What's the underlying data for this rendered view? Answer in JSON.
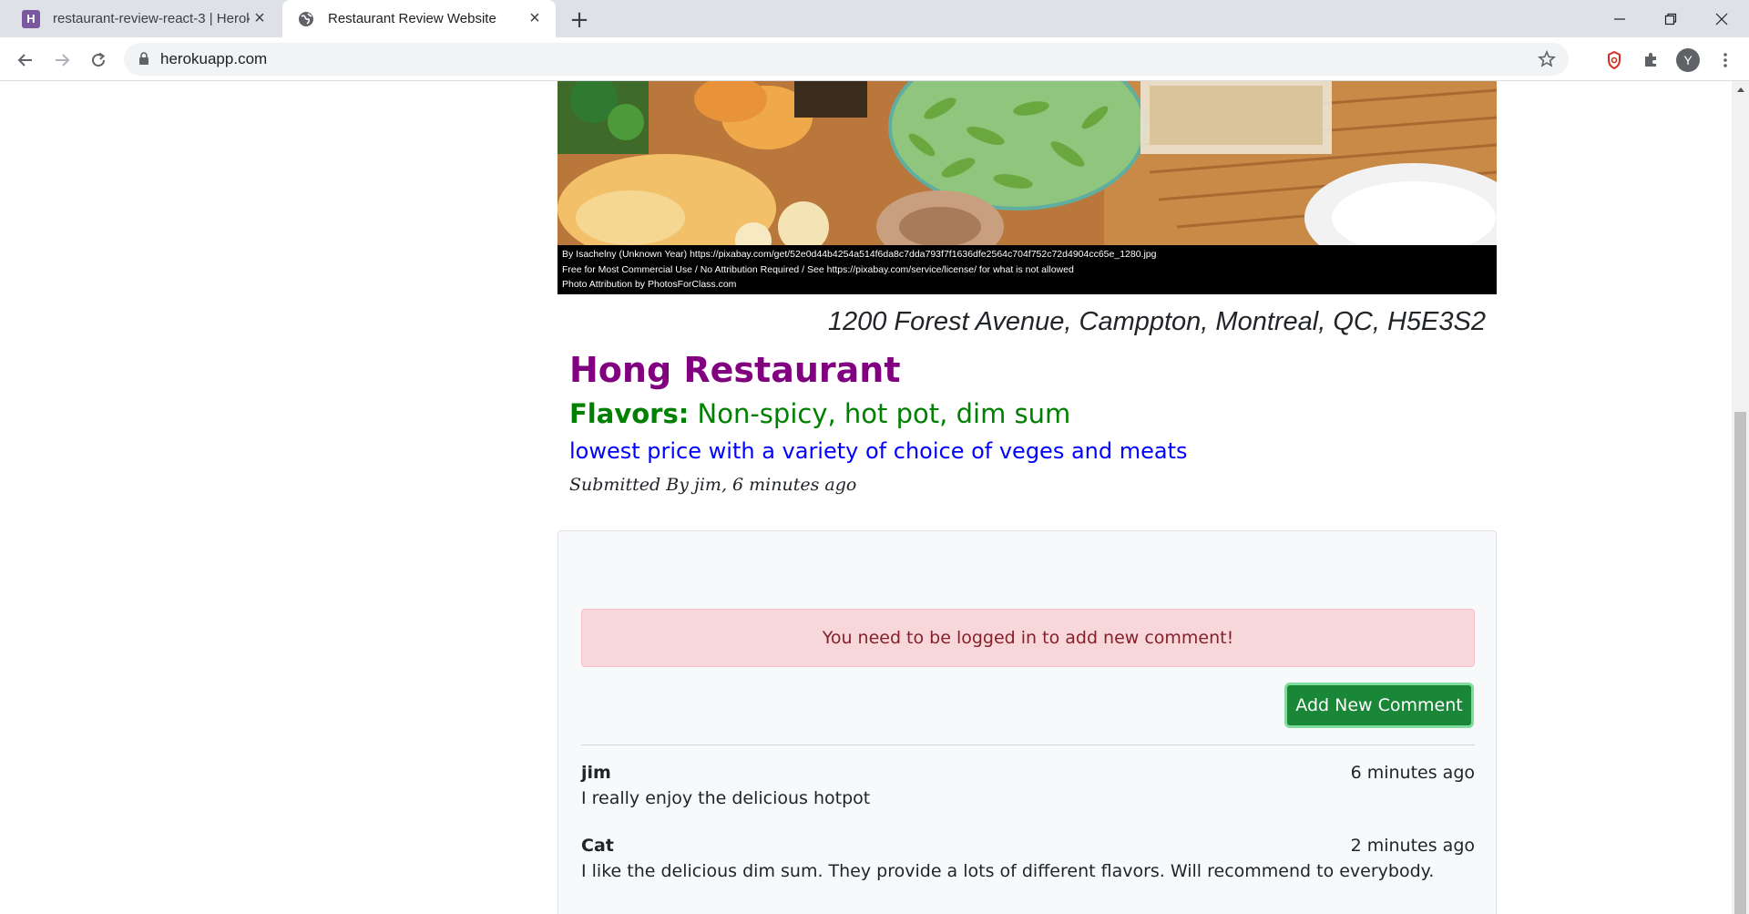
{
  "browser": {
    "tabs": [
      {
        "title": "restaurant-review-react-3 | Herok",
        "favicon": "heroku-icon",
        "active": false
      },
      {
        "title": "Restaurant Review Website",
        "favicon": "globe-icon",
        "active": true
      }
    ],
    "url": "herokuapp.com",
    "profile_initial": "Y"
  },
  "hero": {
    "caption_lines": [
      "By Isachelny (Unknown Year) https://pixabay.com/get/52e0d44b4254a514f6da8c7dda793f7f1636dfe2564c704f752c72d4904cc65e_1280.jpg",
      "Free for Most Commercial Use / No Attribution Required / See https://pixabay.com/service/license/ for what is not allowed",
      "Photo Attribution by PhotosForClass.com"
    ]
  },
  "restaurant": {
    "address": "1200 Forest Avenue, Camppton, Montreal, QC, H5E3S2",
    "name": "Hong Restaurant",
    "flavors_label": "Flavors:",
    "flavors": "Non-spicy, hot pot, dim sum",
    "description": "lowest price with a variety of choice of veges and meats",
    "submitted": "Submitted By jim, 6 minutes ago"
  },
  "comments_section": {
    "login_alert": "You need to be logged in to add new comment!",
    "add_button_label": "Add New Comment",
    "comments": [
      {
        "author": "jim",
        "time": "6 minutes ago",
        "text": "I really enjoy the delicious hotpot"
      },
      {
        "author": "Cat",
        "time": "2 minutes ago",
        "text": "I like the delicious dim sum. They provide a lots of different flavors. Will recommend to everybody."
      }
    ]
  },
  "colors": {
    "restaurant_name": "#800080",
    "flavors": "#008000",
    "description": "#0000ff",
    "alert_bg": "#f8d7da",
    "button_bg": "#198737"
  }
}
